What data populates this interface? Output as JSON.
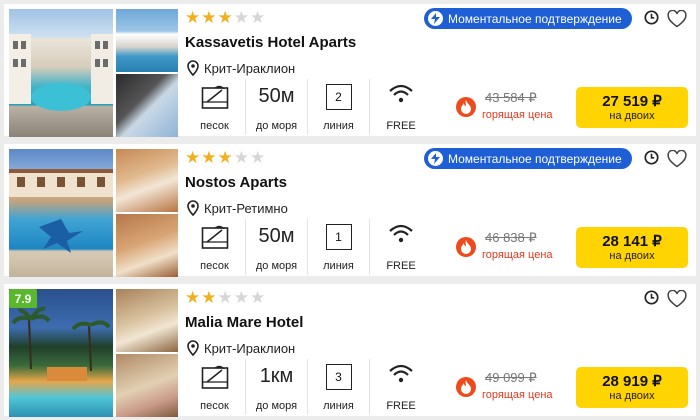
{
  "hotels": [
    {
      "stars": 3,
      "name": "Kassavetis Hotel Aparts",
      "location": "Крит-Ираклион",
      "badge": "Моментальное подтверждение",
      "beach_label": "песок",
      "distance_value": "50м",
      "distance_label": "до моря",
      "line_value": "2",
      "line_label": "линия",
      "wifi_label": "FREE",
      "old_price": "43 584 ₽",
      "hot_label": "горящая цена",
      "price": "27 519 ₽",
      "price_sub": "на двоих",
      "rating": null
    },
    {
      "stars": 3,
      "name": "Nostos Aparts",
      "location": "Крит-Ретимно",
      "badge": "Моментальное подтверждение",
      "beach_label": "песок",
      "distance_value": "50м",
      "distance_label": "до моря",
      "line_value": "1",
      "line_label": "линия",
      "wifi_label": "FREE",
      "old_price": "46 838 ₽",
      "hot_label": "горящая цена",
      "price": "28 141 ₽",
      "price_sub": "на двоих",
      "rating": null
    },
    {
      "stars": 2,
      "name": "Malia Mare Hotel",
      "location": "Крит-Ираклион",
      "badge": null,
      "beach_label": "песок",
      "distance_value": "1км",
      "distance_label": "до моря",
      "line_value": "3",
      "line_label": "линия",
      "wifi_label": "FREE",
      "old_price": "49 099 ₽",
      "hot_label": "горящая цена",
      "price": "28 919 ₽",
      "price_sub": "на двоих",
      "rating": "7.9"
    }
  ],
  "icons": {
    "star": "star-icon",
    "pin": "map-pin-icon",
    "bolt": "lightning-icon",
    "clock": "clock-icon",
    "heart": "heart-icon",
    "beach": "beach-umbrella-icon",
    "wifi": "wifi-icon",
    "flame": "flame-icon"
  },
  "colors": {
    "accent_yellow": "#ffd400",
    "badge_blue": "#1f5fd6",
    "hot_red": "#e03a1e",
    "star_gold": "#f2b01e",
    "rating_green": "#5bb72d"
  }
}
